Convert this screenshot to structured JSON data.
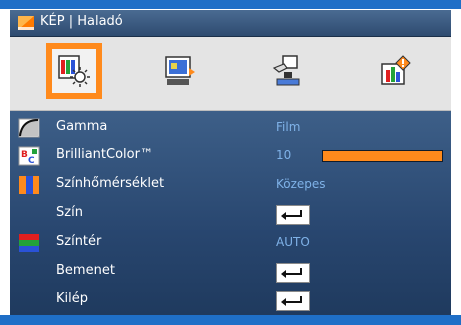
{
  "title": "KÉP | Haladó",
  "tabs": [
    {
      "name": "picture",
      "active": true
    },
    {
      "name": "display",
      "active": false
    },
    {
      "name": "setup",
      "active": false
    },
    {
      "name": "options",
      "active": false
    }
  ],
  "menu": {
    "gamma": {
      "label": "Gamma",
      "value": "Film"
    },
    "brilliant_color": {
      "label": "BrilliantColor™",
      "value": "10",
      "level": 10
    },
    "color_temp": {
      "label": "Színhőmérséklet",
      "value": "Közepes"
    },
    "color": {
      "label": "Szín"
    },
    "color_space": {
      "label": "Színtér",
      "value": "AUTO"
    },
    "input": {
      "label": "Bemenet"
    },
    "exit": {
      "label": "Kilép"
    }
  },
  "colors": {
    "accent": "#ff8a1c",
    "panel": "#2b4a72",
    "value_text": "#7fb2e8"
  }
}
